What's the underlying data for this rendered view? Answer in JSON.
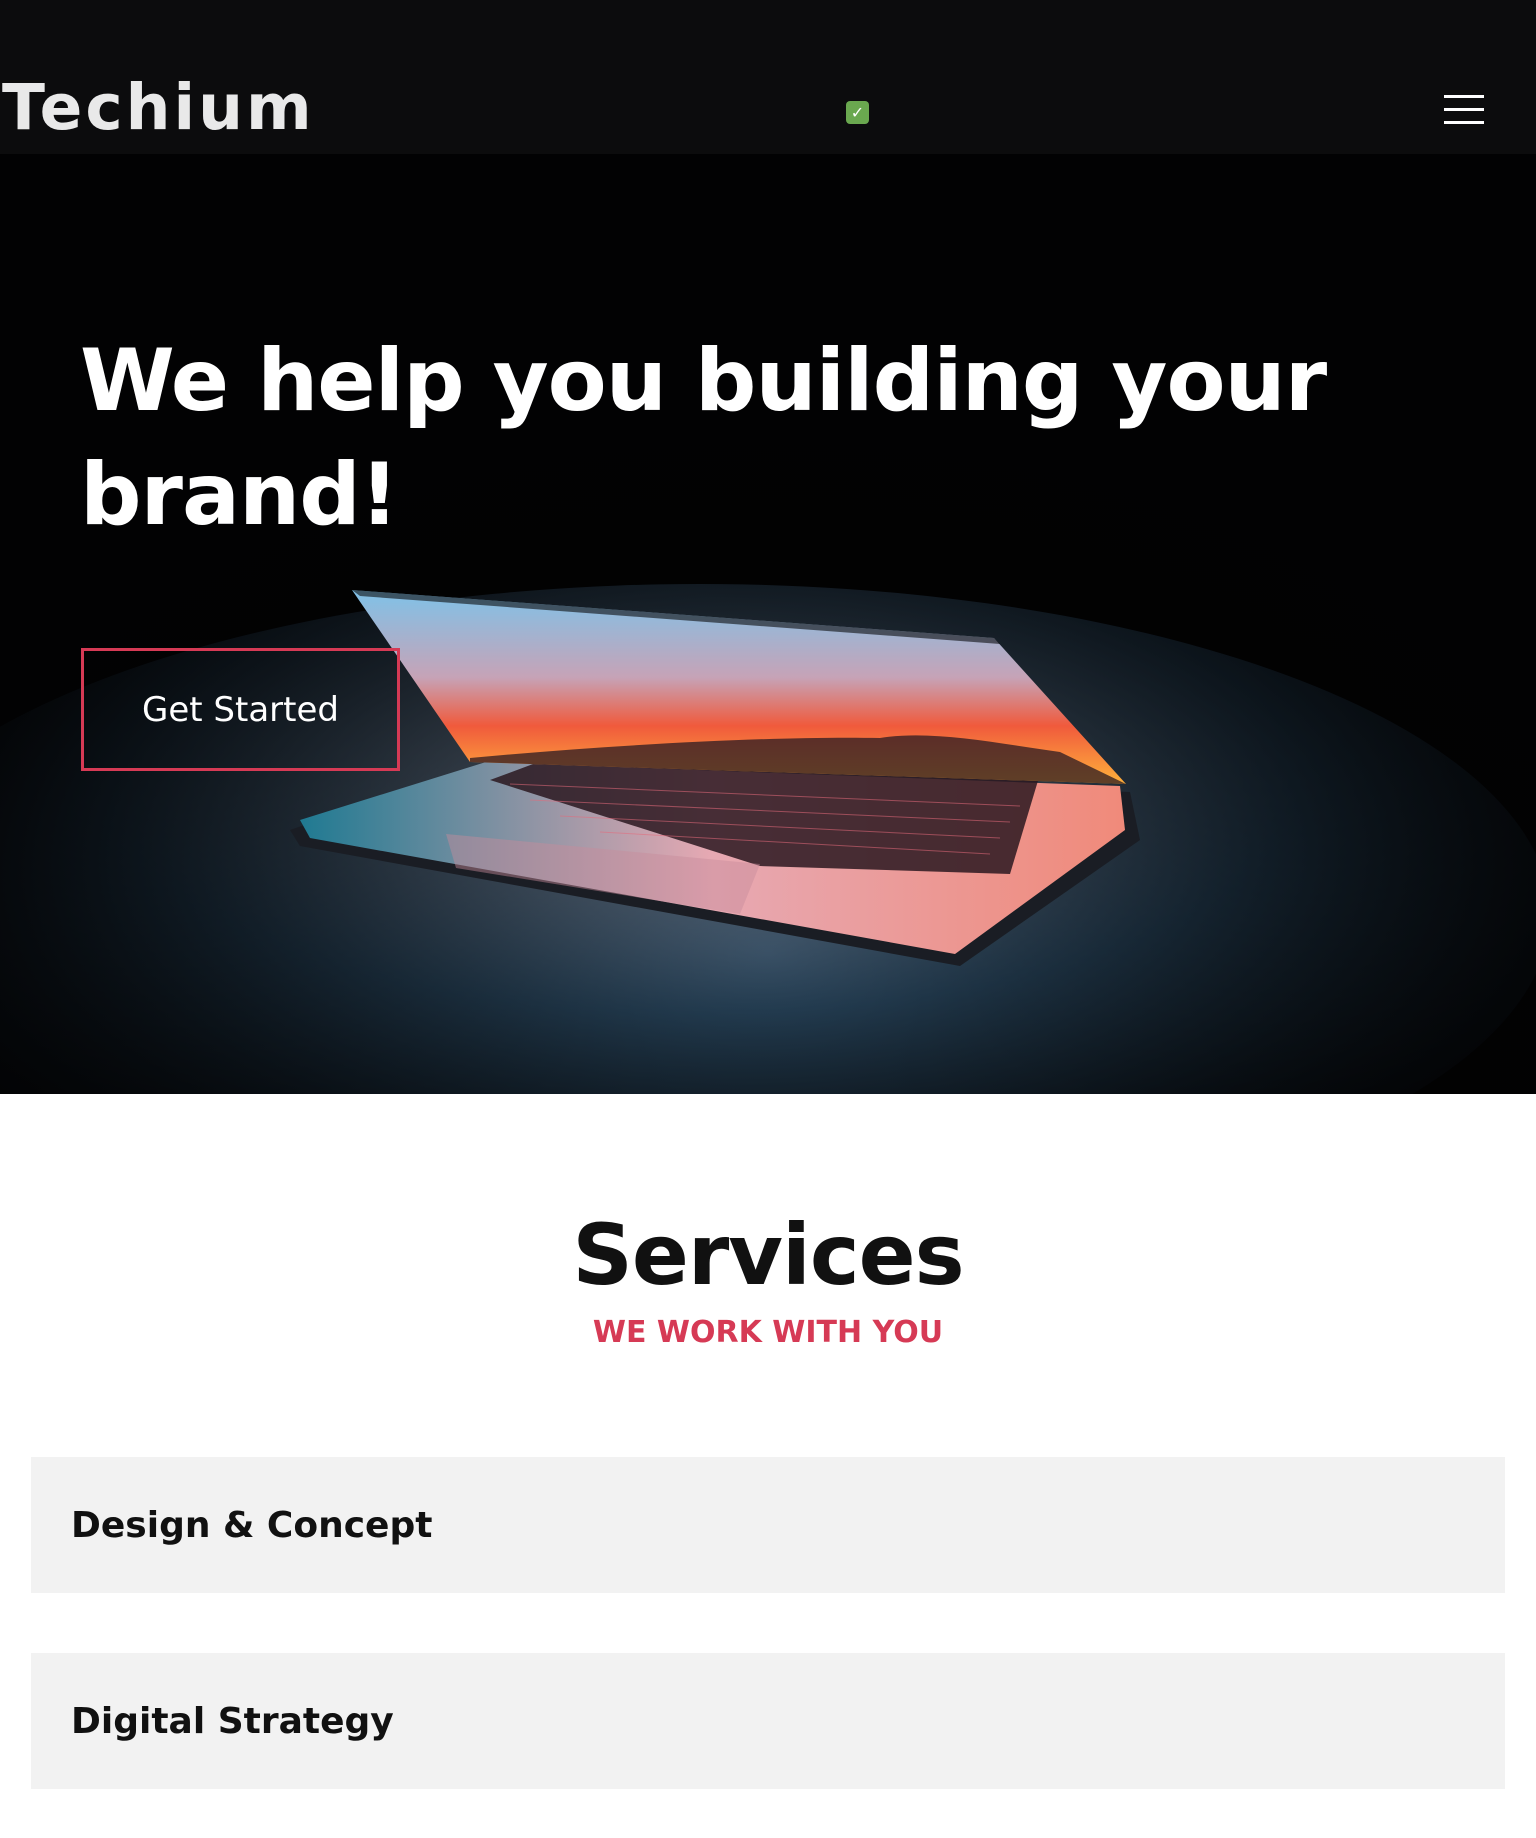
{
  "header": {
    "logo_text": "Techium",
    "status_icon": "check-icon",
    "status_glyph": "✓",
    "menu_icon": "hamburger-menu-icon",
    "background_color": "#0c0c0d"
  },
  "hero": {
    "title": "We help you building your brand!",
    "cta_label": "Get Started",
    "accent_color": "#d63a55",
    "image": "laptop-image"
  },
  "services": {
    "title": "Services",
    "subtitle": "WE WORK WITH YOU",
    "items": [
      {
        "label": "Design & Concept"
      },
      {
        "label": "Digital Strategy"
      }
    ]
  }
}
